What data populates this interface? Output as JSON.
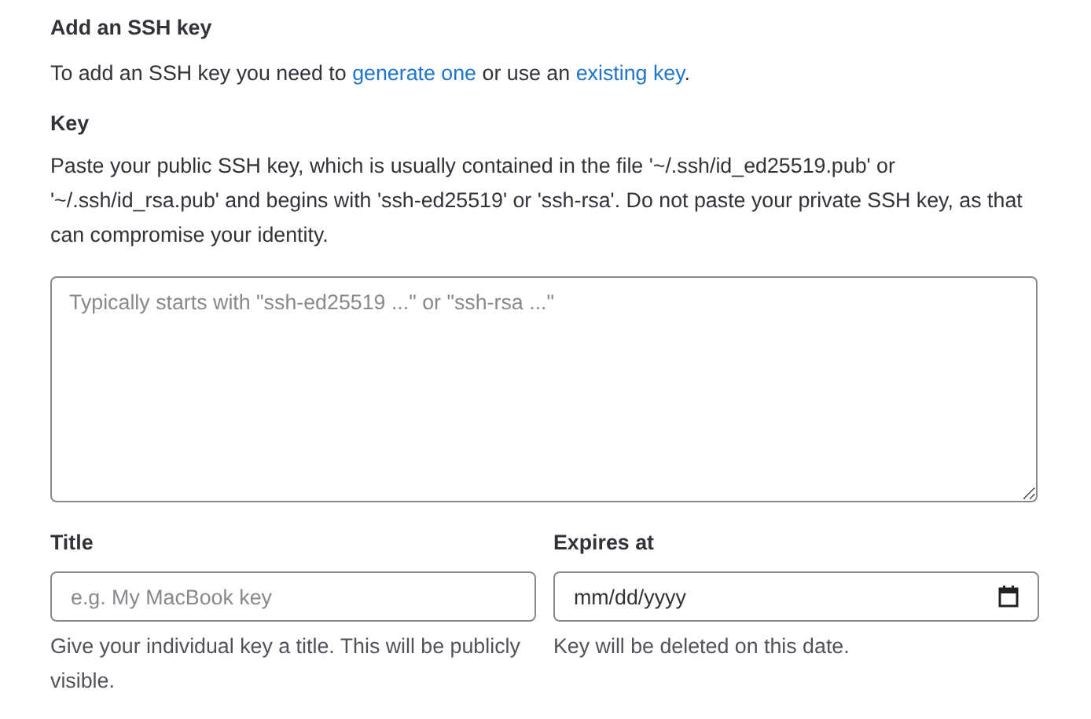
{
  "section": {
    "title": "Add an SSH key",
    "intro": {
      "before": "To add an SSH key you need to",
      "link1": "generate one",
      "middle": "or use an",
      "link2": "existing key",
      "after": "."
    }
  },
  "key": {
    "label": "Key",
    "help": "Paste your public SSH key, which is usually contained in the file '~/.ssh/id_ed25519.pub' or '~/.ssh/id_rsa.pub' and begins with 'ssh-ed25519' or 'ssh-rsa'. Do not paste your private SSH key, as that can compromise your identity.",
    "placeholder": "Typically starts with \"ssh-ed25519 ...\" or \"ssh-rsa ...\""
  },
  "title_field": {
    "label": "Title",
    "placeholder": "e.g. My MacBook key",
    "help": "Give your individual key a title. This will be publicly visible."
  },
  "expires_field": {
    "label": "Expires at",
    "placeholder": "mm/dd/yyyy",
    "help": "Key will be deleted on this date."
  }
}
